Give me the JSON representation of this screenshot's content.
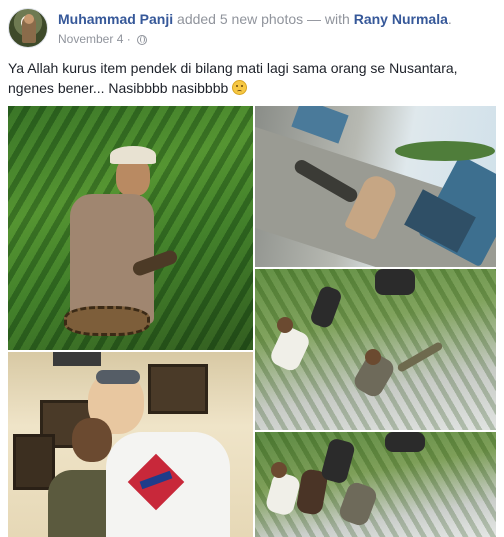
{
  "post": {
    "author": "Muhammad Panji",
    "action": "added 5 new photos",
    "with_prefix": "— with",
    "tagged": "Rany Nurmala",
    "date": "November 4",
    "separator": "·",
    "privacy_icon": "globe-icon",
    "text": "Ya Allah kurus item pendek di bilang mati lagi sama orang se Nusantara, ngenes bener... Nasibbbb nasibbbb",
    "text_emoji": "sad-face-emoji"
  },
  "photos": [
    {
      "id": "photo-1",
      "scene": "man-holding-snake-in-jungle"
    },
    {
      "id": "photo-2",
      "scene": "men-with-snake-near-truck"
    },
    {
      "id": "photo-3",
      "scene": "two-men-posing-indoors"
    },
    {
      "id": "photo-4",
      "scene": "men-catching-snake-in-rice-field"
    },
    {
      "id": "photo-5",
      "scene": "men-in-rice-field"
    }
  ],
  "colors": {
    "link": "#365899",
    "meta": "#90949c",
    "text": "#1d2129"
  }
}
